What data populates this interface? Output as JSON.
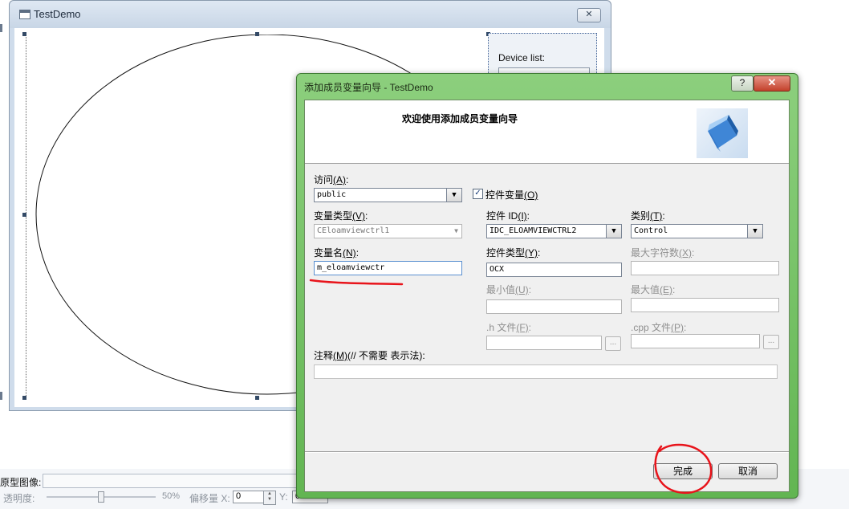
{
  "background_window": {
    "title": "TestDemo",
    "close_glyph": "✕",
    "device_list_label": "Device list:"
  },
  "bottom_bar": {
    "prototype_label": "原型图像:",
    "transparency_label": "透明度:",
    "transparency_value": "50%",
    "offset_label": "偏移量 X:",
    "offset_x": "0",
    "y_label": "Y:",
    "offset_y": "0"
  },
  "dialog": {
    "title": "添加成员变量向导 - TestDemo",
    "help_glyph": "?",
    "close_glyph": "✕",
    "heading": "欢迎使用添加成员变量向导",
    "access": {
      "label": "访问",
      "mnemonic": "(A)",
      "suffix": ":",
      "value": "public"
    },
    "control_variable": {
      "label": "控件变量",
      "mnemonic": "(O)",
      "checked": true,
      "check_glyph": "✓"
    },
    "var_type": {
      "label": "变量类型",
      "mnemonic": "(V)",
      "suffix": ":",
      "value": "CEloamviewctrl1"
    },
    "control_id": {
      "label": "控件 ID",
      "mnemonic": "(I)",
      "suffix": ":",
      "value": "IDC_ELOAMVIEWCTRL2"
    },
    "category": {
      "label": "类别",
      "mnemonic": "(T)",
      "suffix": ":",
      "value": "Control"
    },
    "var_name": {
      "label": "变量名",
      "mnemonic": "(N)",
      "suffix": ":",
      "value": "m_eloamviewctr"
    },
    "control_type": {
      "label": "控件类型",
      "mnemonic": "(Y)",
      "suffix": ":",
      "value": "OCX"
    },
    "max_chars": {
      "label": "最大字符数",
      "mnemonic": "(X)",
      "suffix": ":",
      "value": ""
    },
    "min_value": {
      "label": "最小值",
      "mnemonic": "(U)",
      "suffix": ":",
      "value": ""
    },
    "max_value": {
      "label": "最大值",
      "mnemonic": "(E)",
      "suffix": ":",
      "value": ""
    },
    "h_file": {
      "label": ".h 文件",
      "mnemonic": "(F)",
      "suffix": ":",
      "value": ""
    },
    "cpp_file": {
      "label": ".cpp 文件",
      "mnemonic": "(P)",
      "suffix": ":",
      "value": ""
    },
    "browse_glyph": "...",
    "comment": {
      "label": "注释",
      "mnemonic": "(M)",
      "suffix": "(// 不需要 表示法):",
      "value": ""
    },
    "finish_button": "完成",
    "cancel_button": "取消"
  },
  "colors": {
    "dialog_frame": "#62b552",
    "annotation_red": "#e8141b"
  },
  "icons": [
    "window-icon",
    "close-icon",
    "help-icon",
    "cube-icon",
    "dropdown-arrow-icon",
    "checkbox-checked-icon"
  ]
}
